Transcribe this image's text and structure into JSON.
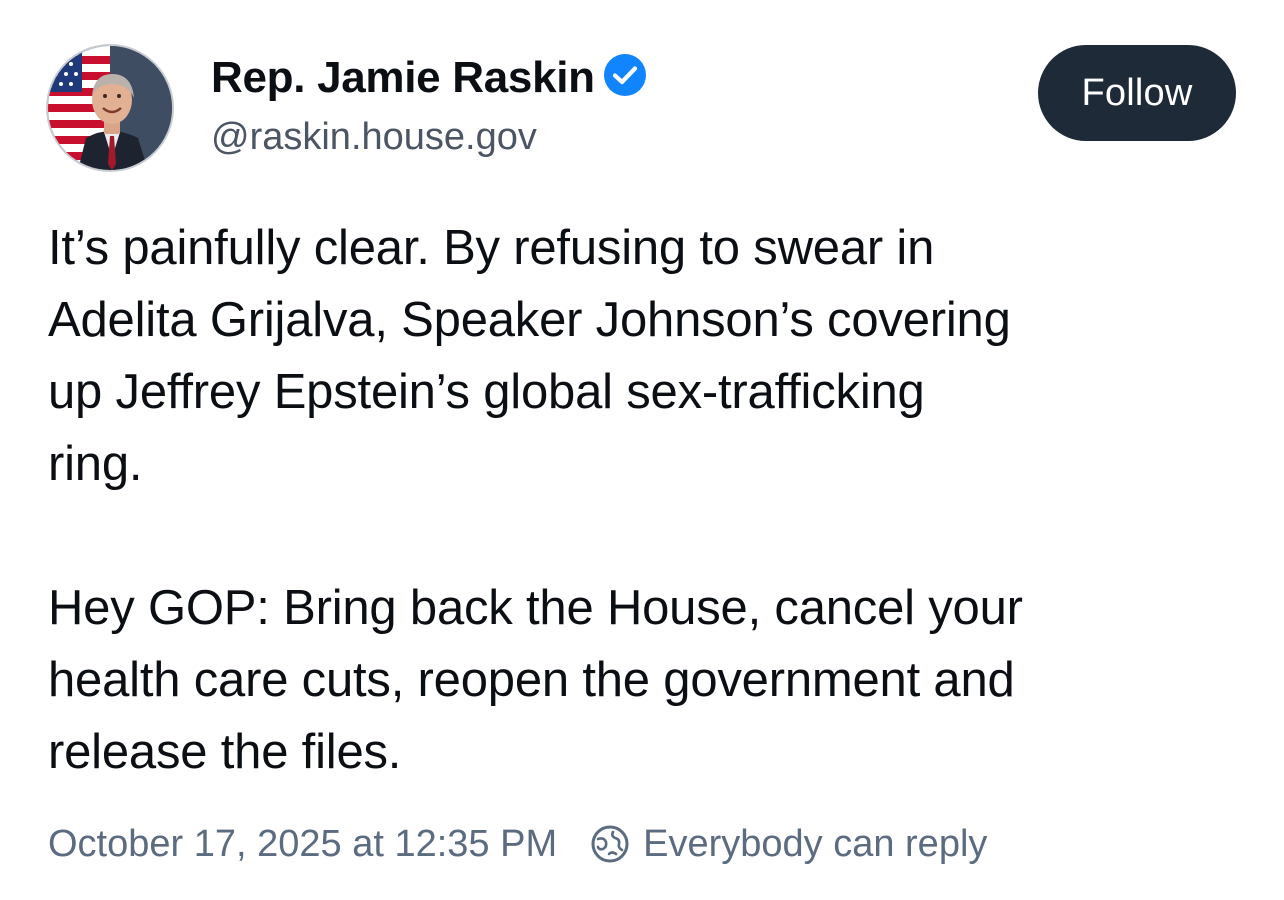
{
  "author": {
    "display_name": "Rep. Jamie Raskin",
    "handle": "@raskin.house.gov",
    "verified": true,
    "avatar_icon": "profile-photo"
  },
  "actions": {
    "follow_label": "Follow"
  },
  "post": {
    "text": "It’s painfully clear. By refusing to swear in\nAdelita Grijalva, Speaker Johnson’s covering\nup Jeffrey Epstein’s global sex-trafficking\nring.\n\nHey GOP: Bring back the House, cancel your\nhealth care cuts, reopen the government and\nrelease the files.",
    "timestamp": "October 17, 2025 at 12:35 PM",
    "reply_setting": "Everybody can reply",
    "reply_setting_icon": "globe-icon"
  },
  "colors": {
    "follow_button_bg": "#1f2a38",
    "verified_badge": "#1185fe",
    "meta_text": "#5b6b80",
    "handle_text": "#4b5563"
  }
}
